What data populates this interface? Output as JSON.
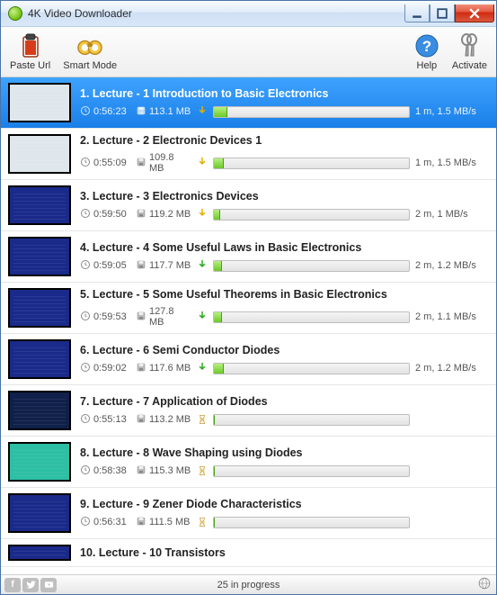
{
  "window": {
    "title": "4K Video Downloader"
  },
  "toolbar": {
    "paste": "Paste Url",
    "smart": "Smart Mode",
    "help": "Help",
    "activate": "Activate"
  },
  "items": [
    {
      "title": "1. Lecture - 1 Introduction to Basic Electronics",
      "duration": "0:56:23",
      "size": "113.1 MB",
      "state": "down",
      "progress": 7,
      "speed": "1 m, 1.5 MB/s",
      "thumb": "white",
      "selected": true
    },
    {
      "title": "2. Lecture - 2 Electronic Devices 1",
      "duration": "0:55:09",
      "size": "109.8 MB",
      "state": "down",
      "progress": 5,
      "speed": "1 m, 1.5 MB/s",
      "thumb": "white"
    },
    {
      "title": "3. Lecture - 3 Electronics Devices",
      "duration": "0:59:50",
      "size": "119.2 MB",
      "state": "down",
      "progress": 3,
      "speed": "2 m, 1 MB/s",
      "thumb": "blue"
    },
    {
      "title": "4. Lecture - 4 Some Useful Laws in Basic Electronics",
      "duration": "0:59:05",
      "size": "117.7 MB",
      "state": "down2",
      "progress": 4,
      "speed": "2 m, 1.2 MB/s",
      "thumb": "blue"
    },
    {
      "title": "5. Lecture - 5 Some Useful Theorems in Basic Electronics",
      "duration": "0:59:53",
      "size": "127.8 MB",
      "state": "down2",
      "progress": 4,
      "speed": "2 m, 1.1 MB/s",
      "thumb": "blue"
    },
    {
      "title": "6. Lecture - 6 Semi Conductor Diodes",
      "duration": "0:59:02",
      "size": "117.6 MB",
      "state": "down2",
      "progress": 5,
      "speed": "2 m, 1.2 MB/s",
      "thumb": "blue"
    },
    {
      "title": "7. Lecture - 7 Application of Diodes",
      "duration": "0:55:13",
      "size": "113.2 MB",
      "state": "wait",
      "progress": 0,
      "speed": "",
      "thumb": "graph"
    },
    {
      "title": "8. Lecture - 8 Wave Shaping using Diodes",
      "duration": "0:58:38",
      "size": "115.3 MB",
      "state": "wait",
      "progress": 0,
      "speed": "",
      "thumb": "scope"
    },
    {
      "title": "9. Lecture - 9 Zener Diode Characteristics",
      "duration": "0:56:31",
      "size": "111.5 MB",
      "state": "wait",
      "progress": 0,
      "speed": "",
      "thumb": "blue"
    },
    {
      "title": "10. Lecture - 10 Transistors",
      "duration": "",
      "size": "",
      "state": "",
      "progress": 0,
      "speed": "",
      "thumb": "blue",
      "partial": true
    }
  ],
  "status": {
    "text": "25 in progress"
  }
}
